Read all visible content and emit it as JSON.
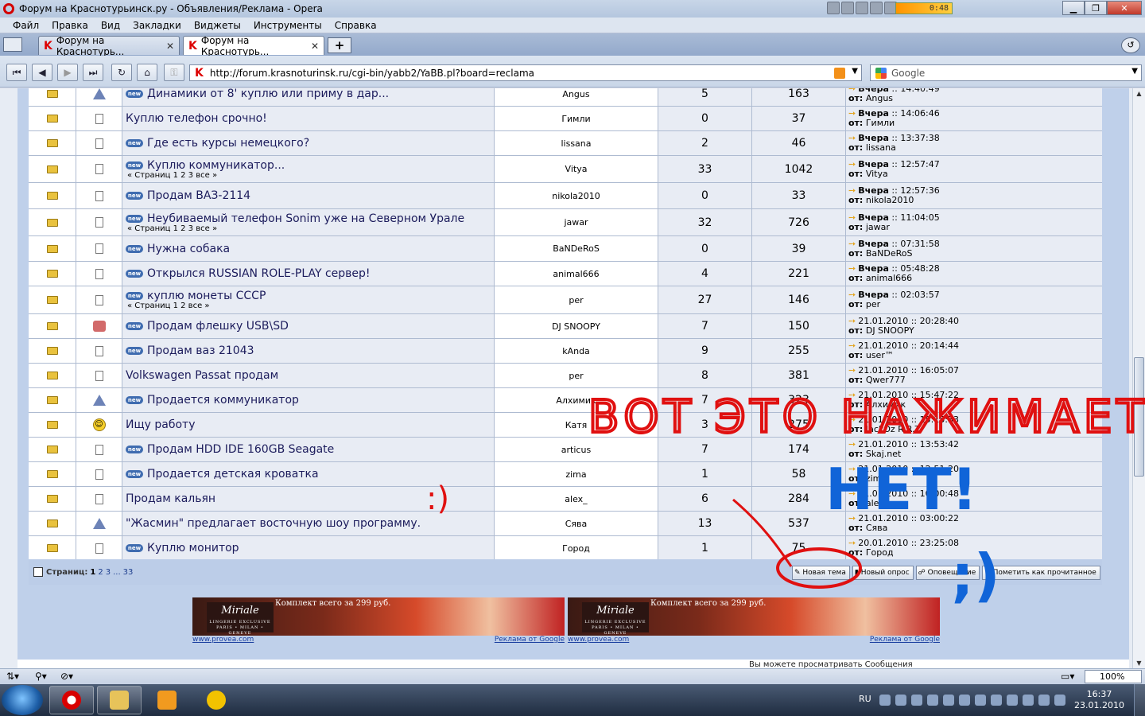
{
  "window": {
    "title": "Форум на Краснотурьинск.ру - Объявления/Реклама - Opera",
    "media_time": "0:48"
  },
  "menu": [
    "Файл",
    "Правка",
    "Вид",
    "Закладки",
    "Виджеты",
    "Инструменты",
    "Справка"
  ],
  "tabs": [
    {
      "label": "Форум на Краснотурь...",
      "active": false
    },
    {
      "label": "Форум на Краснотурь...",
      "active": true
    }
  ],
  "address": {
    "url": "http://forum.krasnoturinsk.ru/cgi-bin/yabb2/YaBB.pl?board=reclama"
  },
  "search": {
    "placeholder": "Google"
  },
  "new_badge": "new",
  "topics": [
    {
      "icon": "warning",
      "new": true,
      "title": "Динамики от 8' куплю или приму в дар...",
      "pages": "",
      "author": "Angus",
      "replies": "5",
      "views": "163",
      "last_date": "Вчера",
      "last_time": ":: 14:40:49",
      "last_by": "Angus",
      "bold_date": true
    },
    {
      "icon": "doc",
      "new": false,
      "title": "Куплю телефон срочно!",
      "pages": "",
      "author": "Гимли",
      "replies": "0",
      "views": "37",
      "last_date": "Вчера",
      "last_time": ":: 14:06:46",
      "last_by": "Гимли",
      "bold_date": true
    },
    {
      "icon": "doc",
      "new": true,
      "title": "Где есть курсы немецкого?",
      "pages": "",
      "author": "lissana",
      "replies": "2",
      "views": "46",
      "last_date": "Вчера",
      "last_time": ":: 13:37:38",
      "last_by": "lissana",
      "bold_date": true
    },
    {
      "icon": "doc",
      "new": true,
      "title": "Куплю коммуникатор...",
      "pages": "« Страниц 1 2 3 все »",
      "author": "Vitya",
      "replies": "33",
      "views": "1042",
      "last_date": "Вчера",
      "last_time": ":: 12:57:47",
      "last_by": "Vitya",
      "bold_date": true
    },
    {
      "icon": "doc",
      "new": true,
      "title": "Продам ВАЗ-2114",
      "pages": "",
      "author": "nikola2010",
      "replies": "0",
      "views": "33",
      "last_date": "Вчера",
      "last_time": ":: 12:57:36",
      "last_by": "nikola2010",
      "bold_date": true
    },
    {
      "icon": "doc",
      "new": true,
      "title": "Неубиваемый телефон Sonim уже на Северном Урале",
      "pages": "« Страниц 1 2 3 все »",
      "author": "jawar",
      "replies": "32",
      "views": "726",
      "last_date": "Вчера",
      "last_time": ":: 11:04:05",
      "last_by": "jawar",
      "bold_date": true
    },
    {
      "icon": "doc",
      "new": true,
      "title": "Нужна собака",
      "pages": "",
      "author": "BaNDeRoS",
      "replies": "0",
      "views": "39",
      "last_date": "Вчера",
      "last_time": ":: 07:31:58",
      "last_by": "BaNDeRoS",
      "bold_date": true
    },
    {
      "icon": "doc",
      "new": true,
      "title": "Открылся RUSSIAN ROLE-PLAY сервер!",
      "pages": "",
      "author": "animal666",
      "replies": "4",
      "views": "221",
      "last_date": "Вчера",
      "last_time": ":: 05:48:28",
      "last_by": "animal666",
      "bold_date": true
    },
    {
      "icon": "doc",
      "new": true,
      "title": "куплю монеты СССР",
      "pages": "« Страниц 1 2 все »",
      "author": "per",
      "replies": "27",
      "views": "146",
      "last_date": "Вчера",
      "last_time": ":: 02:03:57",
      "last_by": "per",
      "bold_date": true
    },
    {
      "icon": "thumb",
      "new": true,
      "title": "Продам флешку USB\\SD",
      "pages": "",
      "author": "DJ SNOOPY",
      "replies": "7",
      "views": "150",
      "last_date": "21.01.2010",
      "last_time": ":: 20:28:40",
      "last_by": "DJ SNOOPY",
      "bold_date": false
    },
    {
      "icon": "doc",
      "new": true,
      "title": "Продам ваз 21043",
      "pages": "",
      "author": "kAnda",
      "replies": "9",
      "views": "255",
      "last_date": "21.01.2010",
      "last_time": ":: 20:14:44",
      "last_by": "user™",
      "bold_date": false
    },
    {
      "icon": "doc",
      "new": false,
      "title": "Volkswagen Passat продам",
      "pages": "",
      "author": "per",
      "replies": "8",
      "views": "381",
      "last_date": "21.01.2010",
      "last_time": ":: 16:05:07",
      "last_by": "Qwer777",
      "bold_date": false
    },
    {
      "icon": "warning",
      "new": true,
      "title": "Продается коммуникатор",
      "pages": "",
      "author": "Алхимик",
      "replies": "7",
      "views": "323",
      "last_date": "21.01.2010",
      "last_time": ":: 15:47:22",
      "last_by": "Алхимик",
      "bold_date": false
    },
    {
      "icon": "smile",
      "new": false,
      "title": "Ищу работу",
      "pages": "",
      "author": "Катя",
      "replies": "3",
      "views": "275",
      "last_date": "21.01.2010",
      "last_time": ":: 15:15:53",
      "last_by": "JackOz R.R.T.",
      "bold_date": false
    },
    {
      "icon": "doc",
      "new": true,
      "title": "Продам HDD IDE 160GB Seagate",
      "pages": "",
      "author": "articus",
      "replies": "7",
      "views": "174",
      "last_date": "21.01.2010",
      "last_time": ":: 13:53:42",
      "last_by": "Skaj.net",
      "bold_date": false
    },
    {
      "icon": "doc",
      "new": true,
      "title": "Продается детская кроватка",
      "pages": "",
      "author": "zima",
      "replies": "1",
      "views": "58",
      "last_date": "21.01.2010",
      "last_time": ":: 12:51:20",
      "last_by": "zima",
      "bold_date": false
    },
    {
      "icon": "doc",
      "new": false,
      "title": "Продам кальян",
      "pages": "",
      "author": "alex_",
      "replies": "6",
      "views": "284",
      "last_date": "21.01.2010",
      "last_time": ":: 10:00:48",
      "last_by": "alex_",
      "bold_date": false
    },
    {
      "icon": "warning",
      "new": false,
      "title": "\"Жасмин\" предлагает восточную шоу программу.",
      "pages": "",
      "author": "Сява",
      "replies": "13",
      "views": "537",
      "last_date": "21.01.2010",
      "last_time": ":: 03:00:22",
      "last_by": "Сява",
      "bold_date": false
    },
    {
      "icon": "doc",
      "new": true,
      "title": "Куплю монитор",
      "pages": "",
      "author": "Город",
      "replies": "1",
      "views": "75",
      "last_date": "20.01.2010",
      "last_time": ":: 23:25:08",
      "last_by": "Город",
      "bold_date": false
    }
  ],
  "last_by_prefix": "от:",
  "pager": {
    "label": "Страниц:",
    "current": "1",
    "pages": [
      "2",
      "3",
      "...",
      "33"
    ]
  },
  "actions": [
    "Новая тема",
    "Новый опрос",
    "Оповещение",
    "Пометить как прочитанное"
  ],
  "ads": [
    {
      "brand": "Miriale",
      "brand_sub": "LINGERIE EXCLUSIVE",
      "brand_cities": "PARIS • MILAN • GENEVE",
      "text": "Комплект всего за 299 руб.",
      "site": "www.provea.com",
      "label": "Реклама от Google"
    },
    {
      "brand": "Miriale",
      "brand_sub": "LINGERIE EXCLUSIVE",
      "brand_cities": "PARIS • MILAN • GENEVE",
      "text": "Комплект всего за 299 руб.",
      "site": "www.provea.com",
      "label": "Реклама от Google"
    }
  ],
  "footer_partial": "Вы можете просматривать Сообщения",
  "zoom": "100%",
  "tray": {
    "lang": "RU",
    "time": "16:37",
    "date": "23.01.2010"
  },
  "annotations": {
    "line1": "ВОТ ЭТО НАЖИМАЕТСЯ?",
    "line2": "НЕТ!",
    "smiley1": ":)",
    "smiley2": ";)"
  }
}
